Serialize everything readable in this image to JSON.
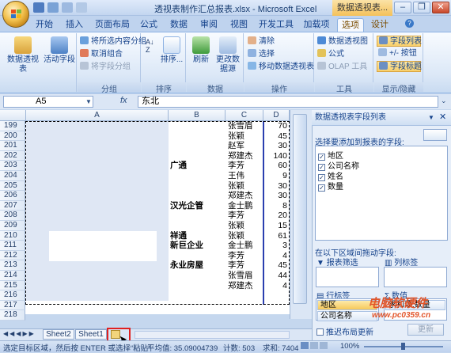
{
  "window": {
    "title": "透视表制作汇总报表.xlsx - Microsoft Excel",
    "context_title": "数据透视表..."
  },
  "tabs": [
    "开始",
    "插入",
    "页面布局",
    "公式",
    "数据",
    "审阅",
    "视图",
    "开发工具",
    "加载项",
    "选项",
    "设计"
  ],
  "active_tab": "选项",
  "ribbon": {
    "pivot_table_label": "数据透视表",
    "active_field_label": "活动字段",
    "group_items": [
      "将所选内容分组",
      "取消组合",
      "将字段分组"
    ],
    "group_label": "分组",
    "sort_label": "排序...",
    "sort_group_label": "排序",
    "refresh_label": "刷新",
    "change_source_label": "更改数据源",
    "data_group_label": "数据",
    "operations": [
      "清除",
      "选择",
      "移动数据透视表"
    ],
    "operations_group_label": "操作",
    "tools": [
      "数据透视图",
      "公式",
      "OLAP 工具"
    ],
    "tools_group_label": "工具",
    "show_items": [
      "字段列表",
      "+/- 按钮",
      "字段标题"
    ],
    "show_group_label": "显示/隐藏"
  },
  "formula_bar": {
    "name_box": "A5",
    "fx": "fx",
    "value": "东北"
  },
  "columns": [
    "A",
    "B",
    "C",
    "D"
  ],
  "rows": [
    {
      "n": "199",
      "b": "",
      "c": "张雪眉",
      "d": "70"
    },
    {
      "n": "200",
      "b": "",
      "c": "张颖",
      "d": "45"
    },
    {
      "n": "201",
      "b": "",
      "c": "赵军",
      "d": "30"
    },
    {
      "n": "202",
      "b": "",
      "c": "郑建杰",
      "d": "140"
    },
    {
      "n": "203",
      "b": "广通",
      "c": "李芳",
      "d": "60"
    },
    {
      "n": "204",
      "b": "",
      "c": "王伟",
      "d": "9"
    },
    {
      "n": "205",
      "b": "",
      "c": "张颖",
      "d": "30"
    },
    {
      "n": "206",
      "b": "",
      "c": "郑建杰",
      "d": "30"
    },
    {
      "n": "207",
      "b": "汉光企管",
      "c": "金士鹏",
      "d": "8"
    },
    {
      "n": "208",
      "b": "",
      "c": "李芳",
      "d": "20"
    },
    {
      "n": "209",
      "b": "",
      "c": "张颖",
      "d": "15"
    },
    {
      "n": "210",
      "b": "祥通",
      "c": "张颖",
      "d": "61"
    },
    {
      "n": "211",
      "b": "新巨企业",
      "c": "金士鹏",
      "d": "3"
    },
    {
      "n": "212",
      "b": "",
      "c": "李芳",
      "d": "4"
    },
    {
      "n": "213",
      "b": "永业房屋",
      "c": "李芳",
      "d": "45"
    },
    {
      "n": "214",
      "b": "",
      "c": "张雪眉",
      "d": "44"
    },
    {
      "n": "215",
      "b": "",
      "c": "郑建杰",
      "d": "4"
    },
    {
      "n": "216",
      "b": "",
      "c": "",
      "d": ""
    },
    {
      "n": "217",
      "b": "",
      "c": "",
      "d": ""
    },
    {
      "n": "218",
      "b": "",
      "c": "",
      "d": ""
    }
  ],
  "sheets": [
    "Sheet2",
    "Sheet1"
  ],
  "status": {
    "message": "选定目标区域，然后按 ENTER 或选择“粘贴”",
    "average": "平均值: 35.09004739",
    "count": "计数: 503",
    "sum": "求和: 7404",
    "zoom": "100%"
  },
  "pane": {
    "title": "数据透视表字段列表",
    "choose_label": "选择要添加到报表的字段:",
    "fields": [
      "地区",
      "公司名称",
      "姓名",
      "数量"
    ],
    "drag_label": "在以下区域间拖动字段:",
    "report_filter": "报表筛选",
    "column_labels": "列标签",
    "row_labels": "行标签",
    "values": "数值",
    "row_items": [
      "地区",
      "公司名称"
    ],
    "value_items": [
      "求和项:数量"
    ],
    "defer_label": "推迟布局更新",
    "update_button": "更新"
  },
  "watermark": {
    "line1": "电脑软硬件",
    "line2": "www.pc0359.cn"
  },
  "colors": {
    "accent": "#15428b",
    "highlight": "#f8cf6a",
    "cursor_box": "#e02020"
  }
}
